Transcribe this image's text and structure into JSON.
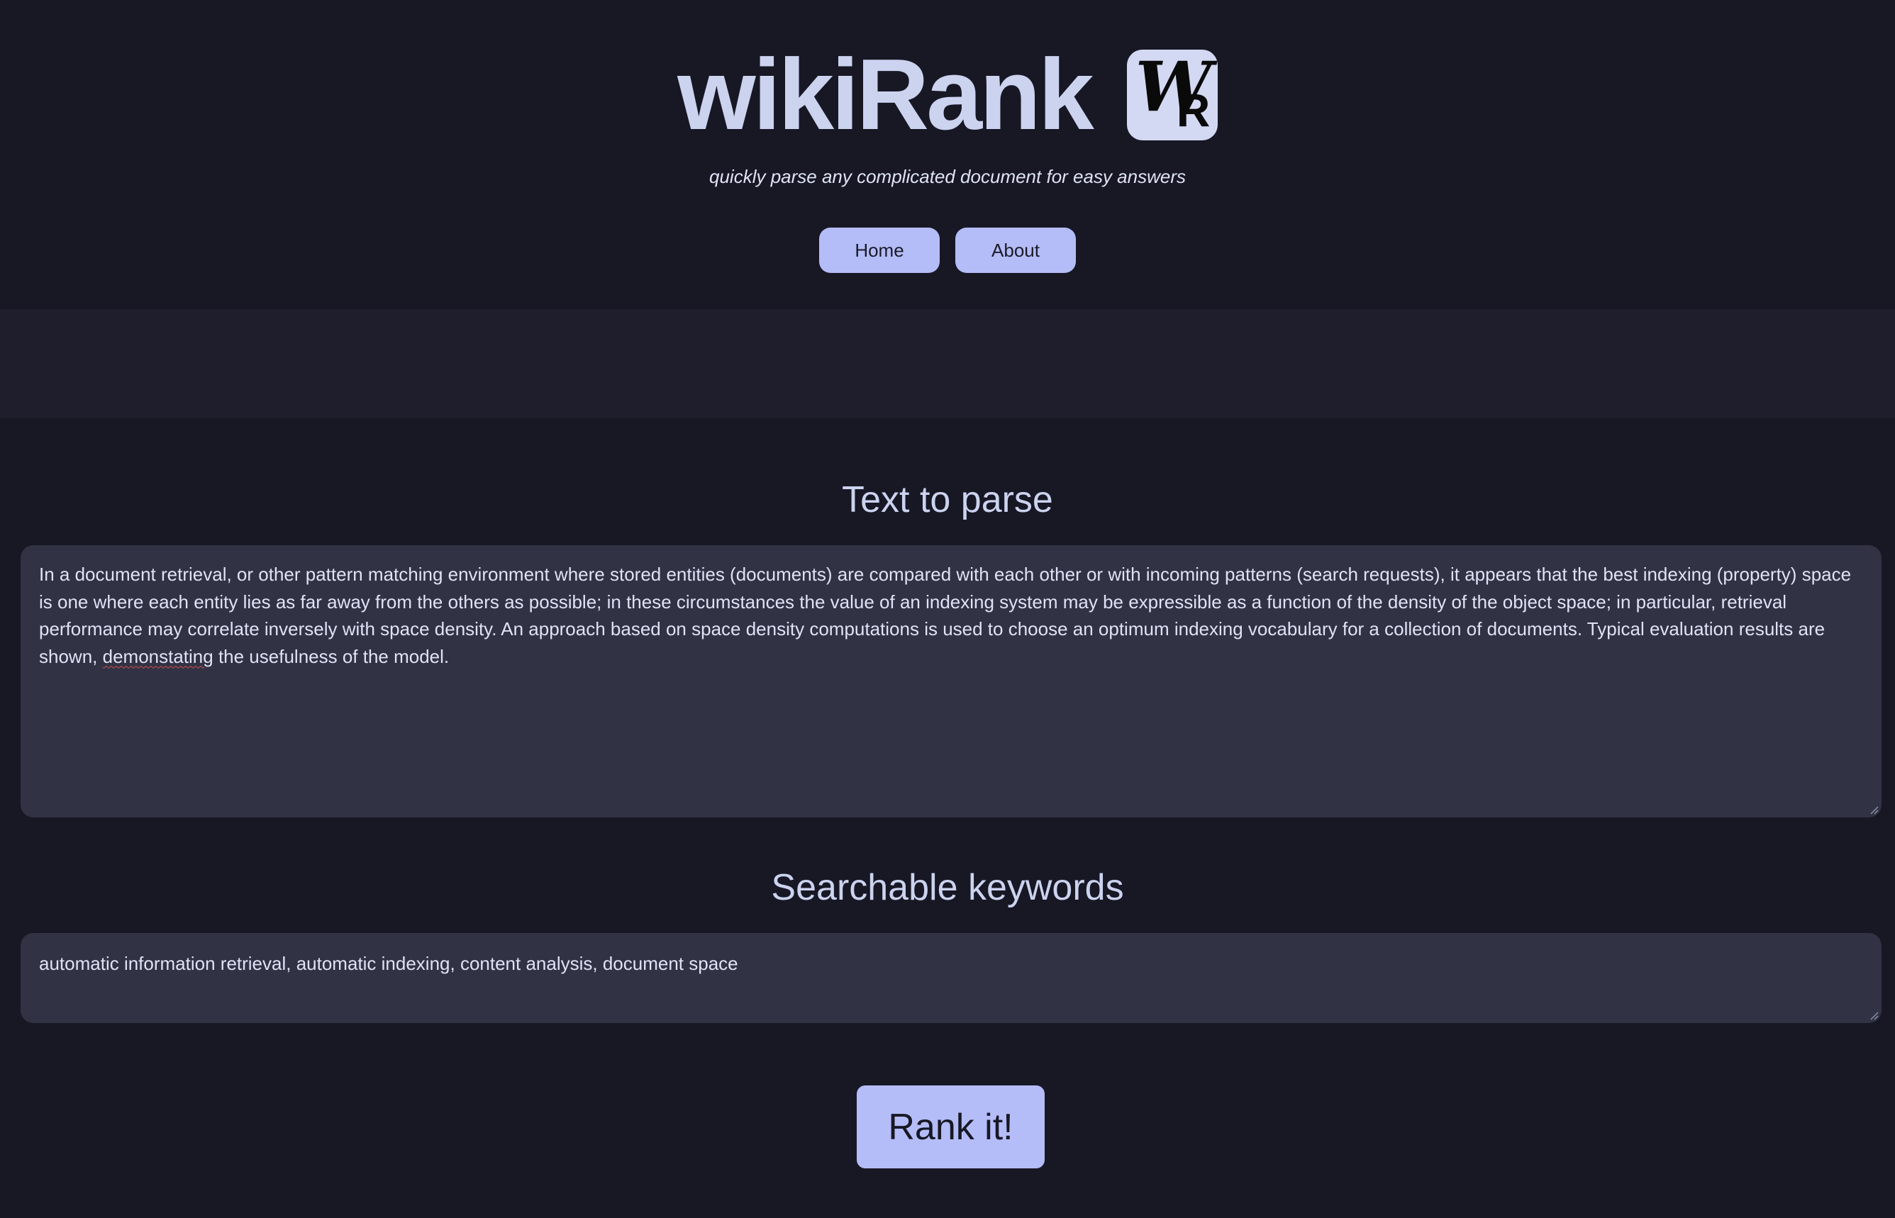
{
  "header": {
    "title": "wikiRank",
    "logo_w": "W",
    "logo_r": "R",
    "tagline": "quickly parse any complicated document for easy answers"
  },
  "nav": {
    "items": [
      {
        "label": "Home"
      },
      {
        "label": "About"
      }
    ]
  },
  "parse_section": {
    "heading": "Text to parse",
    "text_before": "In a document retrieval, or other pattern matching environment where stored entities (documents) are compared with each other or with incoming patterns (search requests), it appears that the best indexing (property) space is one where each entity lies as far away from the others as possible; in these circumstances the value of an indexing system may be expressible as a function of the density of the object space; in particular, retrieval performance may correlate inversely with space density. An approach based on space density computations is used to choose an optimum indexing vocabulary for a collection of documents. Typical evaluation results are shown, ",
    "misspelled_word": "demonstating",
    "text_after": " the usefulness of the model."
  },
  "keywords_section": {
    "heading": "Searchable keywords",
    "value": "automatic information retrieval, automatic indexing, content analysis, document space"
  },
  "submit": {
    "label": "Rank it!"
  },
  "colors": {
    "background": "#181825",
    "band": "#1e1e2c",
    "textarea": "#313244",
    "accent_button": "#b5bdf8",
    "heading_text": "#ccd3ef"
  }
}
